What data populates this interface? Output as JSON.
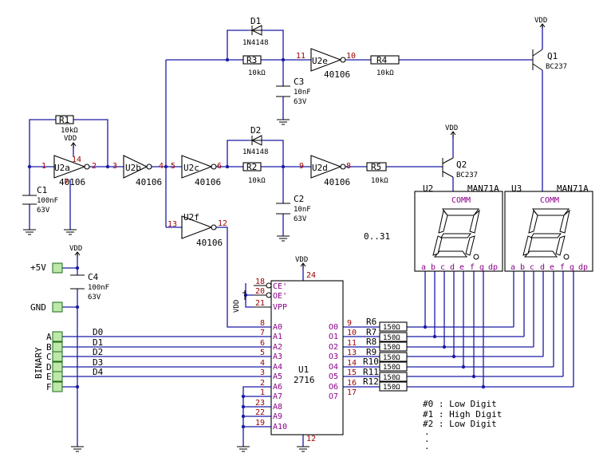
{
  "components": {
    "u2a": {
      "ref": "U2a",
      "part": "40106",
      "in_pin": "1",
      "out_pin": "2",
      "vdd_pin": "14",
      "gnd_pin": "7"
    },
    "u2b": {
      "ref": "U2b",
      "part": "40106",
      "out_pin": "4",
      "in_pin": "3"
    },
    "u2c": {
      "ref": "U2c",
      "part": "40106",
      "in_pin": "5",
      "out_pin": "6"
    },
    "u2d": {
      "ref": "U2d",
      "part": "40106",
      "in_pin": "9",
      "out_pin": "8"
    },
    "u2e": {
      "ref": "U2e",
      "part": "40106",
      "in_pin": "11",
      "out_pin": "10"
    },
    "u2f": {
      "ref": "U2f",
      "part": "40106",
      "in_pin": "13",
      "out_pin": "12"
    },
    "r1": {
      "ref": "R1",
      "value": "10kΩ"
    },
    "r2": {
      "ref": "R2",
      "value": "10kΩ"
    },
    "r3": {
      "ref": "R3",
      "value": "10kΩ"
    },
    "r4": {
      "ref": "R4",
      "value": "10kΩ"
    },
    "r5": {
      "ref": "R5",
      "value": "10kΩ"
    },
    "c1": {
      "ref": "C1",
      "value": "100nF",
      "voltage": "63V"
    },
    "c2": {
      "ref": "C2",
      "value": "10nF",
      "voltage": "63V"
    },
    "c3": {
      "ref": "C3",
      "value": "10nF",
      "voltage": "63V"
    },
    "c4": {
      "ref": "C4",
      "value": "100nF",
      "voltage": "63V"
    },
    "d1": {
      "ref": "D1",
      "part": "1N4148"
    },
    "d2": {
      "ref": "D2",
      "part": "1N4148"
    },
    "q1": {
      "ref": "Q1",
      "part": "BC237"
    },
    "q2": {
      "ref": "Q2",
      "part": "BC237"
    },
    "u1": {
      "ref": "U1",
      "part": "2716",
      "vdd_pin": "24",
      "gnd_pin": "12"
    },
    "u2disp": {
      "ref": "U2",
      "part": "MAN71A"
    },
    "u3disp": {
      "ref": "U3",
      "part": "MAN71A"
    }
  },
  "power": {
    "vdd": "VDD",
    "plus5v": "+5V",
    "gnd": "GND"
  },
  "connector": {
    "title": "BINARY",
    "terminals": [
      "A",
      "B",
      "C",
      "D",
      "E",
      "F"
    ]
  },
  "buses": [
    "D0",
    "D1",
    "D2",
    "D3",
    "D4"
  ],
  "eprom": {
    "addr_labels": [
      "A0",
      "A1",
      "A2",
      "A3",
      "A4",
      "A5",
      "A6",
      "A7",
      "A8",
      "A9",
      "A10"
    ],
    "addr_pins": [
      "8",
      "7",
      "6",
      "5",
      "4",
      "3",
      "2",
      "1",
      "23",
      "22",
      "19"
    ],
    "data_labels": [
      "O0",
      "O1",
      "O2",
      "O3",
      "O4",
      "O5",
      "O6",
      "O7"
    ],
    "data_pins": [
      "9",
      "10",
      "11",
      "13",
      "14",
      "15",
      "16",
      "17"
    ],
    "ctrl_labels": [
      "CE'",
      "OE'",
      "VPP"
    ],
    "ctrl_pins": [
      "18",
      "20",
      "21"
    ]
  },
  "seg_resistors": {
    "refs": [
      "R6",
      "R7",
      "R8",
      "R9",
      "R10",
      "R11",
      "R12"
    ],
    "value": "150Ω"
  },
  "display": {
    "comm": "COMM",
    "segments": [
      "a",
      "b",
      "c",
      "d",
      "e",
      "f",
      "g",
      "dp"
    ]
  },
  "range_text": "0..31",
  "notes": [
    "#0 : Low Digit",
    "#1 : High Digit",
    "#2 : Low Digit",
    ".",
    ".",
    "."
  ]
}
